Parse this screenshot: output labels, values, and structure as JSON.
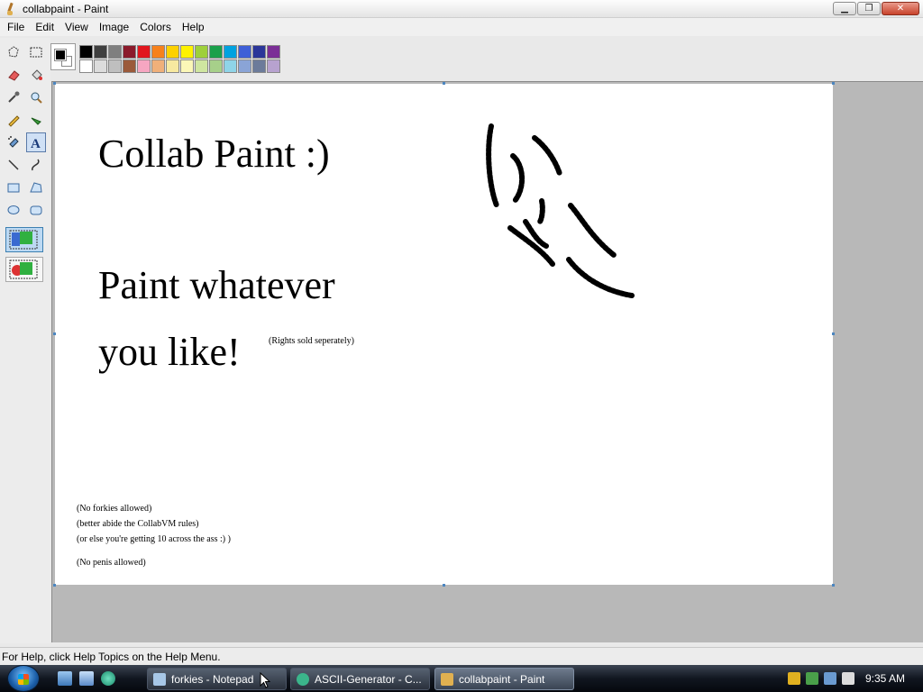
{
  "window": {
    "title": "collabpaint - Paint",
    "minimize": "▁",
    "maximize": "❐",
    "close": "✕"
  },
  "menu": [
    "File",
    "Edit",
    "View",
    "Image",
    "Colors",
    "Help"
  ],
  "palette": {
    "foreground": "#000000",
    "background": "#ffffff",
    "row1": [
      "#000000",
      "#3f3f3f",
      "#7f7f7f",
      "#8b1a2b",
      "#e1161e",
      "#f7811c",
      "#fdd100",
      "#fef200",
      "#9ed03b",
      "#1aa04b",
      "#00a2e0",
      "#3e5fd7",
      "#2b3699",
      "#7b2f96"
    ],
    "row2": [
      "#ffffff",
      "#dcdcdc",
      "#bfbfbf",
      "#9b5a3a",
      "#f6a6c1",
      "#f0b07a",
      "#f7e9a0",
      "#fbf7b7",
      "#cfe6a0",
      "#a7d08a",
      "#8fd4e8",
      "#8aa4d6",
      "#6c7b9a",
      "#b7a2cf"
    ]
  },
  "tools": [
    "free-select-icon",
    "rect-select-icon",
    "eraser-icon",
    "fill-icon",
    "color-picker-icon",
    "magnifier-icon",
    "pencil-icon",
    "brush-icon",
    "airbrush-icon",
    "text-icon",
    "line-icon",
    "curve-icon",
    "rectangle-icon",
    "polygon-icon",
    "ellipse-icon",
    "rounded-rect-icon"
  ],
  "canvas": {
    "title_line": "Collab Paint :)",
    "line2": "Paint whatever",
    "line3": "you like!",
    "rights": "(Rights sold seperately)",
    "note1": "(No forkies allowed)",
    "note2": "(better abide the CollabVM rules)",
    "note3": "(or else you're getting 10 across the ass :) )",
    "note4": "(No penis allowed)"
  },
  "status": "For Help, click Help Topics on the Help Menu.",
  "taskbar": {
    "tasks": [
      {
        "label": "forkies - Notepad",
        "color": "#a7c7e7"
      },
      {
        "label": "ASCII-Generator - C...",
        "color": "#3bb58b"
      },
      {
        "label": "collabpaint - Paint",
        "color": "#e0b050"
      }
    ],
    "clock": "9:35 AM"
  }
}
